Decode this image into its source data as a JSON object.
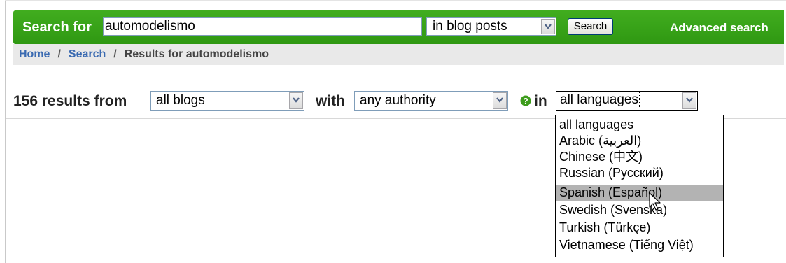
{
  "search": {
    "label": "Search for",
    "query": "automodelismo",
    "scope": "in blog posts",
    "button": "Search",
    "advanced_link": "Advanced search"
  },
  "breadcrumb": {
    "home": "Home",
    "sep": "/",
    "search": "Search",
    "current": "Results for automodelismo"
  },
  "results": {
    "count_label": "156 results from",
    "blogs_select": "all blogs",
    "with_label": "with",
    "authority_select": "any authority",
    "in_label": "in",
    "language_select": "all languages"
  },
  "language_options": [
    "all languages",
    "Arabic (العربية)",
    "Chinese (中文)",
    "Russian (Русский)",
    "Spanish (Español)",
    "Swedish (Svenska)",
    "Turkish (Türkçe)",
    "Vietnamese (Tiếng Việt)"
  ],
  "highlighted_option": "Spanish (Español)",
  "colors": {
    "green_bar": "#35a017",
    "link_blue": "#3a6ab1",
    "breadcrumb_bg": "#e9e9e9",
    "highlight": "#b3b3b3"
  },
  "icons": [
    "dropdown-arrow-icon",
    "help-icon",
    "mouse-cursor-icon"
  ]
}
